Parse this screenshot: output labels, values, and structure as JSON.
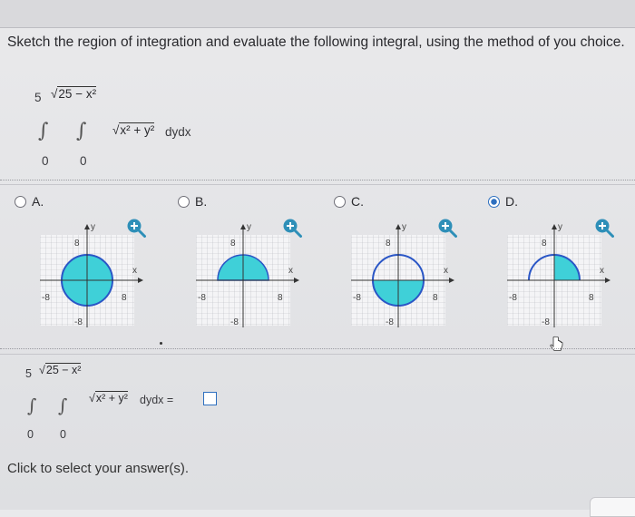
{
  "question": {
    "text": "Sketch the region of integration and evaluate the following integral, using the method of you choice."
  },
  "integral": {
    "outer_upper": "5",
    "inner_upper": "25 − x²",
    "outer_lower": "0",
    "inner_lower": "0",
    "integrand": "x² + y²",
    "differentials": "dydx"
  },
  "options": [
    {
      "label": "A.",
      "selected": false
    },
    {
      "label": "B.",
      "selected": false
    },
    {
      "label": "C.",
      "selected": false
    },
    {
      "label": "D.",
      "selected": true
    }
  ],
  "graph_labels": {
    "y": "y",
    "x": "x",
    "pos": "8",
    "neg": "-8"
  },
  "answer": {
    "outer_upper": "5",
    "inner_upper": "25 − x²",
    "outer_lower": "0",
    "inner_lower": "0",
    "integrand": "x² + y²",
    "differentials": "dydx =",
    "value": ""
  },
  "hint": "Click to select your answer(s).",
  "colors": {
    "fill": "#3fd0d8",
    "outline": "#2a56c6",
    "accent": "#2d6fbf",
    "zoom": "#2e8fb8"
  }
}
